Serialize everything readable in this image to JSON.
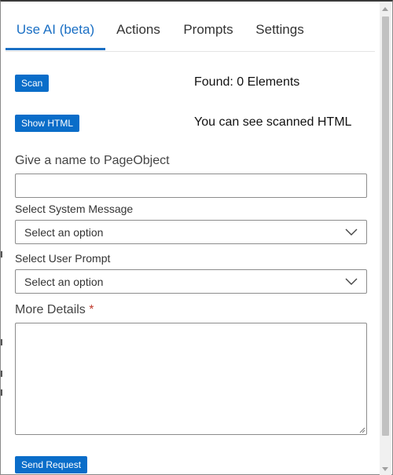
{
  "tabs": [
    {
      "label": "Use AI (beta)",
      "active": true
    },
    {
      "label": "Actions",
      "active": false
    },
    {
      "label": "Prompts",
      "active": false
    },
    {
      "label": "Settings",
      "active": false
    }
  ],
  "scan": {
    "button_label": "Scan",
    "status": "Found: 0 Elements"
  },
  "html_view": {
    "button_label": "Show HTML",
    "hint": "You can see scanned HTML"
  },
  "form": {
    "page_object_label": "Give a name to PageObject",
    "page_object_value": "",
    "system_message_label": "Select System Message",
    "system_message_value": "Select an option",
    "user_prompt_label": "Select User Prompt",
    "user_prompt_value": "Select an option",
    "details_label": "More Details",
    "details_required_mark": "*",
    "details_value": "",
    "submit_label": "Send Request"
  },
  "icons": {
    "select_arrow": "chevron-down-icon",
    "textarea_resize": "resize-grip-icon"
  },
  "colors": {
    "accent": "#1a6fc4",
    "button": "#0a6dc9",
    "required": "#c0392b"
  }
}
